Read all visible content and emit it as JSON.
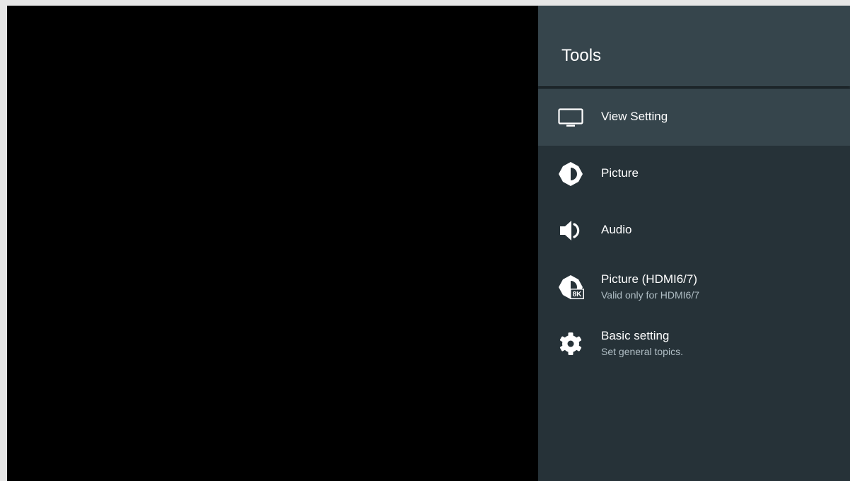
{
  "panel": {
    "title": "Tools",
    "items": [
      {
        "label": "View Setting",
        "icon": "tv-icon",
        "selected": true
      },
      {
        "label": "Picture",
        "icon": "brightness-icon"
      },
      {
        "label": "Audio",
        "icon": "speaker-icon"
      },
      {
        "label": "Picture (HDMI6/7)",
        "subtitle": "Valid only for HDMI6/7",
        "icon": "picture-8k-icon",
        "badge": "8K"
      },
      {
        "label": "Basic setting",
        "subtitle": "Set general topics.",
        "icon": "gear-icon"
      }
    ]
  },
  "colors": {
    "panel_bg": "#263238",
    "header_bg": "#36454c",
    "selected_bg": "#36454c",
    "subtitle_text": "#b0bec5"
  }
}
